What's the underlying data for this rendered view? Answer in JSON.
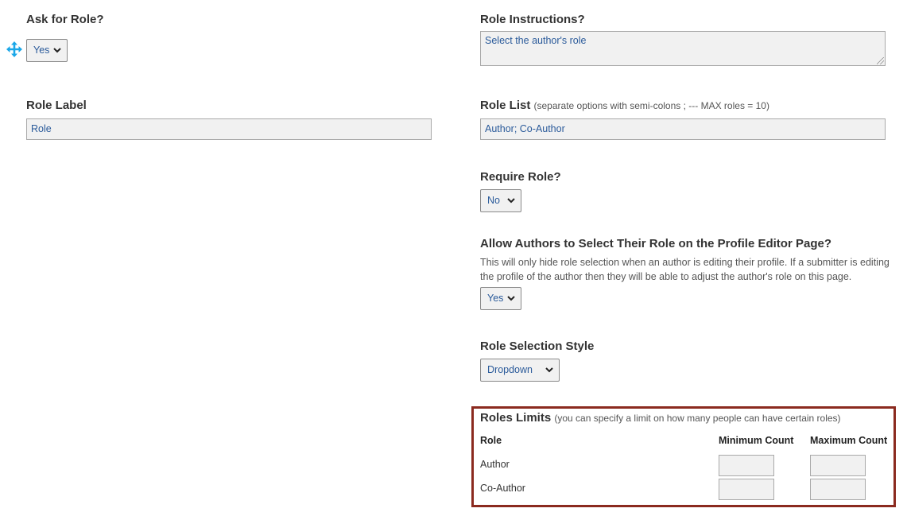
{
  "ask_for_role": {
    "label": "Ask for Role?",
    "value": "Yes"
  },
  "role_instructions": {
    "label": "Role Instructions?",
    "value": "Select the author's role"
  },
  "role_label": {
    "label": "Role Label",
    "value": "Role"
  },
  "role_list": {
    "label": "Role List",
    "hint": "(separate options with semi-colons ; --- MAX roles = 10)",
    "value": "Author; Co-Author"
  },
  "require_role": {
    "label": "Require Role?",
    "value": "No"
  },
  "allow_authors_select": {
    "label": "Allow Authors to Select Their Role on the Profile Editor Page?",
    "description_line1": "This will only hide role selection when an author is editing their profile. If a submitter is editing",
    "description_line2": "the profile of the author then they will be able to adjust the author's role on this page.",
    "value": "Yes"
  },
  "role_selection_style": {
    "label": "Role Selection Style",
    "value": "Dropdown"
  },
  "roles_limits": {
    "label": "Roles Limits",
    "hint": "(you can specify a limit on how many people can have certain roles)",
    "columns": {
      "role": "Role",
      "minimum": "Minimum Count",
      "maximum": "Maximum Count"
    },
    "rows": [
      {
        "role": "Author",
        "minimum": "",
        "maximum": ""
      },
      {
        "role": "Co-Author",
        "minimum": "",
        "maximum": ""
      }
    ],
    "highlight_color": "#8b2a1f"
  },
  "icons": {
    "drag_handle": "move-arrows-icon",
    "dropdown": "chevron-down-icon"
  },
  "colors": {
    "input_text": "#2a5a9a",
    "input_bg": "#f1f1f1",
    "move_icon": "#1aa7e8"
  }
}
